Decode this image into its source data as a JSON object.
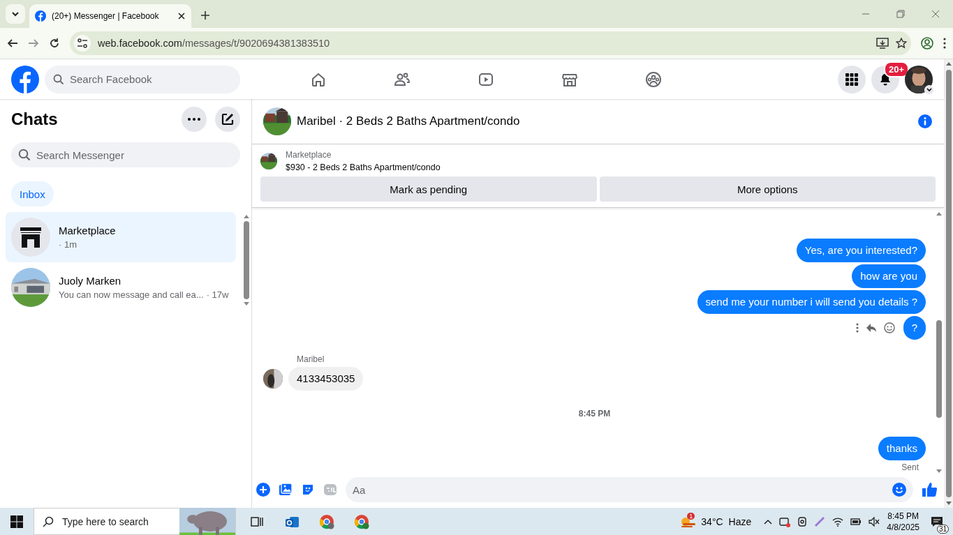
{
  "browser": {
    "tab": {
      "title": "(20+) Messenger | Facebook"
    },
    "url": {
      "host": "web.facebook.com",
      "path": "/messages/t/9020694381383510"
    }
  },
  "topbar": {
    "search": {
      "placeholder": "Search Facebook"
    },
    "nav": [
      {
        "kind": "home",
        "selected": false
      },
      {
        "kind": "friends",
        "selected": false
      },
      {
        "kind": "video",
        "selected": false
      },
      {
        "kind": "marketplace",
        "selected": false
      },
      {
        "kind": "groups",
        "selected": false
      }
    ],
    "notifications_badge": "20+"
  },
  "chats": {
    "title": "Chats",
    "search": {
      "placeholder": "Search Messenger"
    },
    "filters": [
      {
        "label": "Inbox",
        "selected": true
      }
    ],
    "conversations": [
      {
        "kind": "store",
        "name": "Marketplace",
        "time": "· 1m",
        "selected": true
      },
      {
        "kind": "picture",
        "name": "Juoly Marken",
        "preview": "You can now message and call ea...",
        "time": "· 17w",
        "selected": false
      }
    ]
  },
  "conversation": {
    "title": "Maribel · 2 Beds 2 Baths Apartment/condo",
    "listing": {
      "label": "Marketplace",
      "title": "$930 - 2 Beds 2 Baths Apartment/condo",
      "buttons": [
        "Mark as pending",
        "More options"
      ]
    },
    "messages": [
      {
        "kind": "sent",
        "text": "Yes, are you interested?",
        "actions_shown": false
      },
      {
        "kind": "sent",
        "text": "how are you",
        "actions_shown": false
      },
      {
        "kind": "sent",
        "text": "send me your number i will send you details ?",
        "actions_shown": false
      },
      {
        "kind": "sent",
        "text": "?",
        "actions_shown": true
      },
      {
        "kind": "received",
        "sender": "Maribel",
        "text": "4133453035"
      },
      {
        "kind": "time",
        "text": "8:45 PM"
      },
      {
        "kind": "sent",
        "text": "thanks",
        "actions_shown": false,
        "status": "Sent"
      }
    ],
    "composer": {
      "placeholder": "Aa"
    }
  },
  "taskbar": {
    "search": {
      "placeholder": "Type here to search"
    },
    "weather": {
      "badge": "1",
      "temperature": "34°C",
      "condition": "Haze"
    },
    "time": "8:45 PM",
    "date": "4/8/2025",
    "notifications": "31"
  }
}
